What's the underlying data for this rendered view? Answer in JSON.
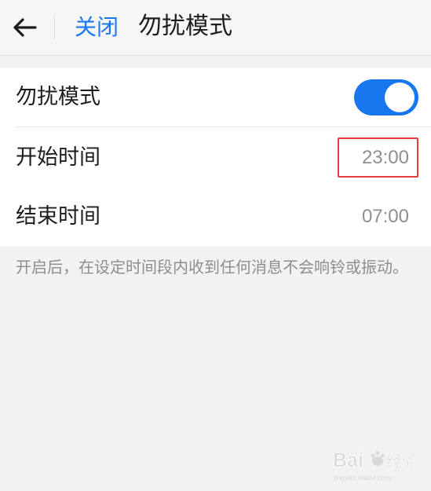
{
  "header": {
    "close_label": "关闭",
    "title": "勿扰模式",
    "back_icon": "arrow-left-icon"
  },
  "settings": {
    "rows": [
      {
        "label": "勿扰模式",
        "control": "toggle",
        "toggle_on": true,
        "toggle_color": "#1876EE"
      },
      {
        "label": "开始时间",
        "value": "23:00",
        "highlighted": true,
        "highlight_color": "#E43D3D"
      },
      {
        "label": "结束时间",
        "value": "07:00"
      }
    ]
  },
  "description": "开启后，在设定时间段内收到任何消息不会响铃或振动。",
  "watermark": {
    "text": "Bai 经验",
    "subtext": "jingyan.baidu.com"
  },
  "colors": {
    "accent": "#1A78F2",
    "background": "#F2F2F3",
    "row_background": "#FFFFFF",
    "secondary_text": "#8E8E8E"
  }
}
